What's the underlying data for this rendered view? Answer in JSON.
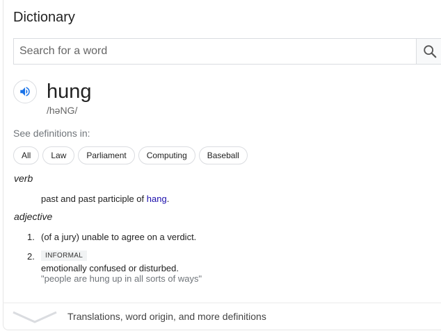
{
  "header": {
    "title": "Dictionary"
  },
  "search": {
    "placeholder": "Search for a word",
    "button_icon": "search-icon"
  },
  "entry": {
    "word": "hung",
    "phonetic": "/həNG/",
    "audio_icon": "speaker-icon"
  },
  "see_definitions": {
    "label": "See definitions in:",
    "chips": [
      "All",
      "Law",
      "Parliament",
      "Computing",
      "Baseball"
    ]
  },
  "verb": {
    "pos": "verb",
    "def_prefix": "past and past participle of ",
    "def_link": "hang",
    "def_suffix": "."
  },
  "adjective": {
    "pos": "adjective",
    "senses": [
      {
        "num": "1.",
        "text": "(of a jury) unable to agree on a verdict."
      },
      {
        "num": "2.",
        "badge": "INFORMAL",
        "text": "emotionally confused or disturbed.",
        "example": "\"people are hung up in all sorts of ways\""
      }
    ]
  },
  "footer": {
    "more_label": "Translations, word origin, and more definitions",
    "icon": "chevron-down-icon"
  },
  "colors": {
    "link": "#1a0dab",
    "speaker": "#1a73e8"
  }
}
